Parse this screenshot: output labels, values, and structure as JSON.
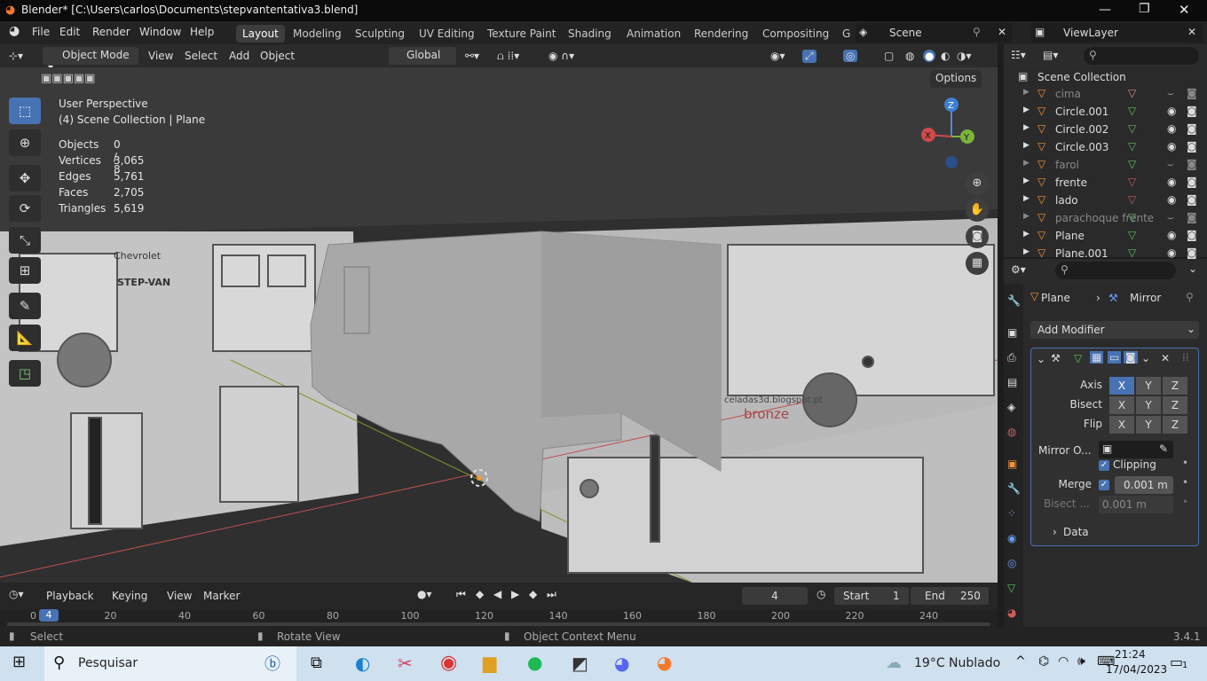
{
  "window": {
    "title": "Blender* [C:\\Users\\carlos\\Documents\\stepvantentativa3.blend]"
  },
  "menu": [
    "File",
    "Edit",
    "Render",
    "Window",
    "Help"
  ],
  "workspaces": [
    "Layout",
    "Modeling",
    "Sculpting",
    "UV Editing",
    "Texture Paint",
    "Shading",
    "Animation",
    "Rendering",
    "Compositing",
    "G"
  ],
  "scene": "Scene",
  "view_layer": "ViewLayer",
  "vpheader": {
    "mode": "Object Mode",
    "menus": [
      "View",
      "Select",
      "Add",
      "Object"
    ],
    "orientation": "Global",
    "options": "Options"
  },
  "overlay": {
    "title": "User Perspective",
    "subtitle": "(4) Scene Collection | Plane",
    "stats": [
      {
        "k": "Objects",
        "v": "0 / 8"
      },
      {
        "k": "Vertices",
        "v": "3,065"
      },
      {
        "k": "Edges",
        "v": "5,761"
      },
      {
        "k": "Faces",
        "v": "2,705"
      },
      {
        "k": "Triangles",
        "v": "5,619"
      }
    ]
  },
  "gizmo": {
    "z": "Z",
    "y": "Y",
    "x": "X"
  },
  "outliner": {
    "root": "Scene Collection",
    "items": [
      {
        "name": "cima",
        "dim": true
      },
      {
        "name": "Circle.001",
        "dim": false
      },
      {
        "name": "Circle.002",
        "dim": false
      },
      {
        "name": "Circle.003",
        "dim": false
      },
      {
        "name": "farol",
        "dim": true
      },
      {
        "name": "frente",
        "dim": false
      },
      {
        "name": "lado",
        "dim": false
      },
      {
        "name": "parachoque frente",
        "dim": true
      },
      {
        "name": "Plane",
        "dim": false
      },
      {
        "name": "Plane.001",
        "dim": false
      }
    ]
  },
  "props": {
    "object": "Plane",
    "modifier": "Mirror",
    "add_modifier": "Add Modifier",
    "axis_label": "Axis",
    "bisect_label": "Bisect",
    "flip_label": "Flip",
    "xyz": [
      "X",
      "Y",
      "Z"
    ],
    "mirror_obj": "Mirror O...",
    "clipping": "Clipping",
    "merge": "Merge",
    "merge_val": "0.001 m",
    "bisect_dist": "Bisect ...",
    "bisect_val": "0.001 m",
    "data": "Data"
  },
  "timeline": {
    "menus": [
      "Playback",
      "Keying",
      "View",
      "Marker"
    ],
    "frame": "4",
    "start_label": "Start",
    "start": "1",
    "end_label": "End",
    "end": "250",
    "ticks": [
      "0",
      "20",
      "40",
      "60",
      "80",
      "100",
      "120",
      "140",
      "160",
      "180",
      "200",
      "220",
      "240"
    ],
    "current": "4"
  },
  "status": {
    "select": "Select",
    "rotate": "Rotate View",
    "context": "Object Context Menu",
    "version": "3.4.1"
  },
  "viewport_text": {
    "chevrolet": "Chevrolet",
    "stepvan": "STEP-VAN",
    "blog": "celadas3d.blogspot.pt",
    "bronze": "bronze"
  },
  "taskbar": {
    "search": "Pesquisar",
    "weather": "19°C  Nublado",
    "time": "21:24",
    "date": "17/04/2023",
    "notif": "1"
  }
}
